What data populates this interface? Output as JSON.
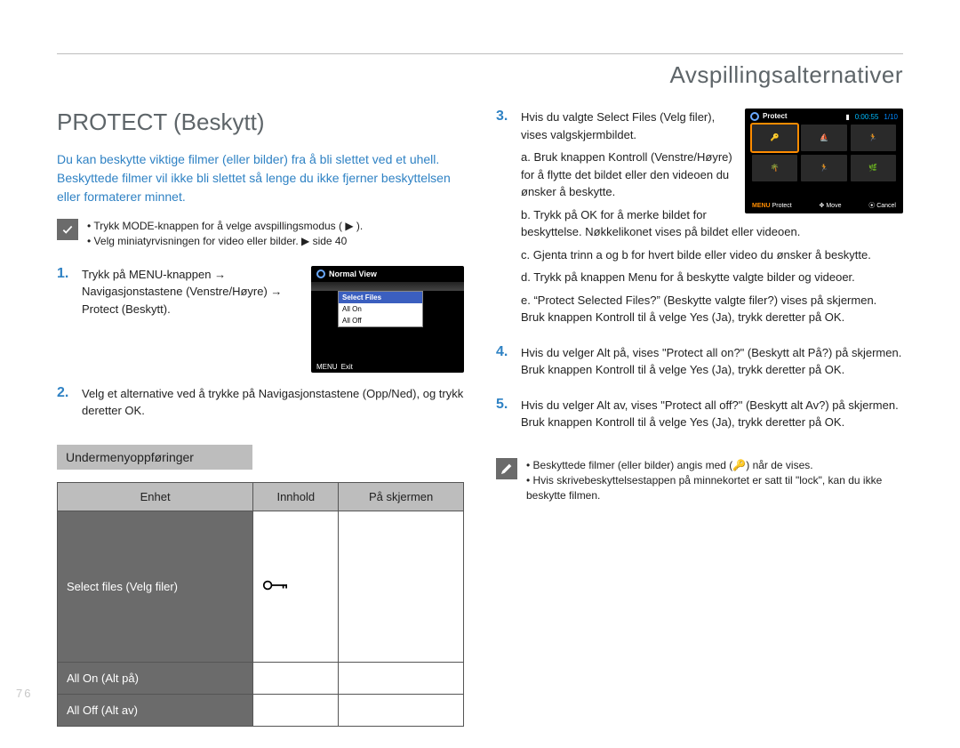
{
  "chapter": "Avspillingsalternativer",
  "title": "PROTECT (Beskytt)",
  "intro": "Du kan beskytte viktige filmer (eller bilder) fra å bli slettet ved et uhell. Beskyttede filmer vil ikke bli slettet så lenge du ikke fjerner beskyttelsen eller formaterer minnet.",
  "callout": {
    "lines": [
      "Trykk MODE-knappen for å velge avspillingsmodus ( ▶ ).",
      "Velg miniatyrvisningen for video eller bilder. ▶ side 40"
    ]
  },
  "step1": "Trykk på MENU-knappen → Navigasjonstastene (Venstre/Høyre) → Protect (Beskytt).",
  "step2": "Velg et alternative ved å trykke på Navigasjonstastene (Opp/Ned), og trykk deretter OK.",
  "screenA": {
    "title": "Normal View",
    "items": [
      "Select Files",
      "All On",
      "All Off"
    ],
    "menu": "MENU",
    "exit": "Exit"
  },
  "submenuTitle": "Undermenyoppføringer",
  "table": {
    "head": {
      "c1": "Enhet",
      "c2": "Innhold",
      "c3": "På skjermen"
    },
    "rows": [
      {
        "c1": "Select files (Velg filer)",
        "icon": true
      },
      {
        "c1": "All On (Alt på)"
      },
      {
        "c1": "All Off (Alt av)"
      }
    ]
  },
  "step3": {
    "lead": "Hvis du valgte Select Files (Velg filer), vises valgskjermbildet.",
    "a": "Bruk knappen Kontroll (Venstre/Høyre) for å flytte det bildet eller den videoen du ønsker å beskytte.",
    "b": "Trykk på OK for å merke bildet for beskyttelse. Nøkkelikonet vises på bildet eller videoen.",
    "c": "Gjenta trinn a og b for hvert bilde eller video du ønsker å beskytte.",
    "d": "Trykk på knappen Menu for å beskytte valgte bilder og videoer.",
    "e": "“Protect Selected Files?” (Beskytte valgte filer?) vises på skjermen. Bruk knappen Kontroll til å velge Yes (Ja), trykk deretter på OK."
  },
  "screenB": {
    "title": "Protect",
    "time": "0:00:55",
    "count": "1/10",
    "foot": {
      "menu": "MENU",
      "protect": "Protect",
      "move": "Move",
      "cancel": "Cancel"
    }
  },
  "step4": "Hvis du velger Alt på, vises \"Protect all on?\" (Beskytt alt På?) på skjermen. Bruk knappen Kontroll til å velge Yes (Ja), trykk deretter på OK.",
  "step5": "Hvis du velger Alt av, vises \"Protect all off?\" (Beskytt alt Av?) på skjermen. Bruk knappen Kontroll til å velge Yes (Ja), trykk deretter på OK.",
  "note": {
    "a": "Beskyttede filmer (eller bilder) angis med (🔑) når de vises.",
    "b": "Hvis skrivebeskyttelsestappen på minnekortet er satt til \"lock\", kan du ikke beskytte filmen."
  },
  "pageNumber": "76"
}
